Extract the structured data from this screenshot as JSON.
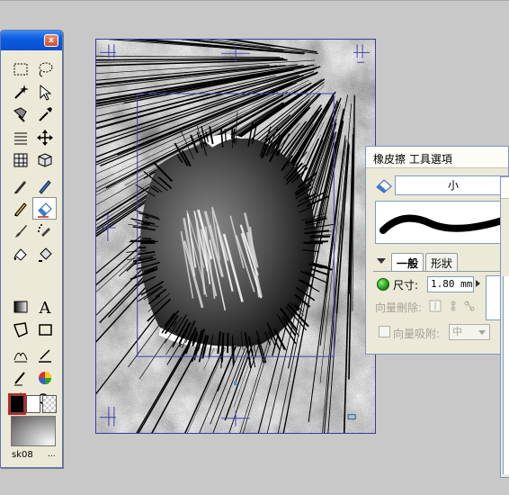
{
  "tools_palette": {
    "close_label": "x",
    "tools": [
      {
        "name": "rect-select-icon",
        "active": false
      },
      {
        "name": "lasso-icon",
        "active": false
      },
      {
        "name": "magic-wand-icon",
        "active": false
      },
      {
        "name": "pointer-icon",
        "active": false
      },
      {
        "name": "select-pen-icon",
        "active": false
      },
      {
        "name": "eyedropper-icon",
        "active": false
      },
      {
        "name": "horizontal-lines-icon",
        "active": false
      },
      {
        "name": "move-icon",
        "active": false
      },
      {
        "name": "grid-icon",
        "active": false
      },
      {
        "name": "cube-icon",
        "active": false
      },
      {
        "name": "pen-icon",
        "active": false
      },
      {
        "name": "marker-icon",
        "active": false
      },
      {
        "name": "pencil-icon",
        "active": false
      },
      {
        "name": "eraser-icon",
        "active": true
      },
      {
        "name": "brush-icon",
        "active": false
      },
      {
        "name": "airbrush-icon",
        "active": false
      },
      {
        "name": "fill-icon",
        "active": false
      },
      {
        "name": "fill-bucket-icon",
        "active": false
      },
      {
        "name": "gradient-icon",
        "active": false
      },
      {
        "name": "text-icon",
        "active": false
      },
      {
        "name": "polygon-icon",
        "active": false
      },
      {
        "name": "rectangle-icon",
        "active": false
      },
      {
        "name": "rough-icon",
        "active": false
      },
      {
        "name": "correction-icon",
        "active": false
      },
      {
        "name": "line-icon",
        "active": false
      },
      {
        "name": "color-wheel-icon",
        "active": false
      },
      {
        "name": "hand-icon",
        "active": false
      },
      {
        "name": "zoom-icon",
        "active": false
      }
    ],
    "colors": {
      "main": "#000000",
      "sub": "#ffffff",
      "accent": "#cc2020"
    },
    "brush_name": "sk08",
    "brush_more": "..."
  },
  "eraser_panel": {
    "title": "橡皮擦 工具選項",
    "size_preset": "小",
    "tabs": [
      {
        "label": "一般",
        "active": true
      },
      {
        "label": "形狀",
        "active": false
      }
    ],
    "size_label": "尺寸:",
    "size_value": "1.80 mm",
    "vector_erase_label": "向量刪除:",
    "vector_snap_label": "向量吸附:",
    "vector_snap_value": "中",
    "vector_snap_checked": false
  }
}
